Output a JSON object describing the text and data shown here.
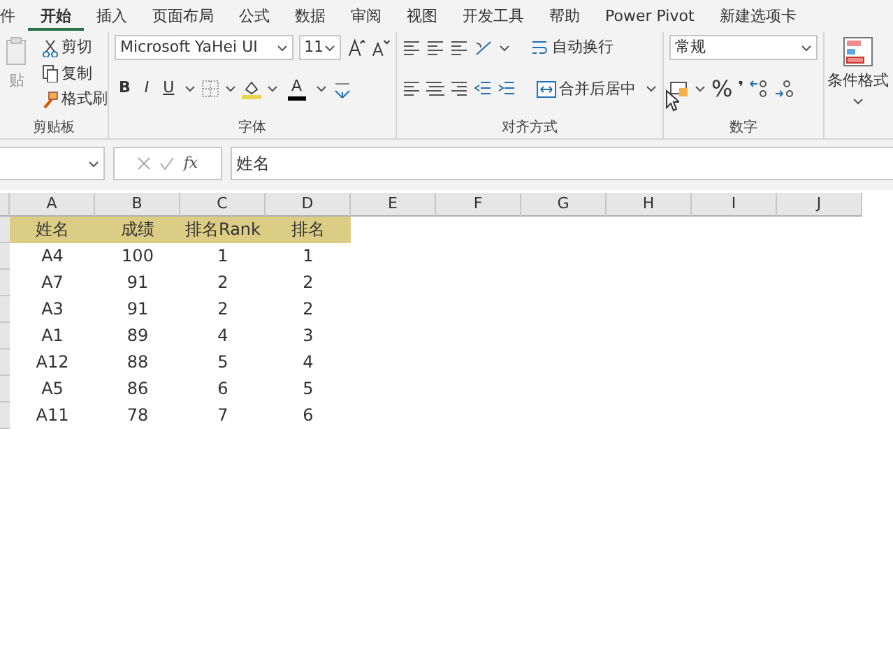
{
  "tabs": [
    {
      "label": "件",
      "selected": false
    },
    {
      "label": "开始",
      "selected": true
    },
    {
      "label": "插入",
      "selected": false
    },
    {
      "label": "页面布局",
      "selected": false
    },
    {
      "label": "公式",
      "selected": false
    },
    {
      "label": "数据",
      "selected": false
    },
    {
      "label": "审阅",
      "selected": false
    },
    {
      "label": "视图",
      "selected": false
    },
    {
      "label": "开发工具",
      "selected": false
    },
    {
      "label": "帮助",
      "selected": false
    },
    {
      "label": "Power Pivot",
      "selected": false
    },
    {
      "label": "新建选项卡",
      "selected": false
    }
  ],
  "clipboard": {
    "paste": "贴",
    "cut": "剪切",
    "copy": "复制",
    "painter": "格式刷",
    "label": "剪贴板"
  },
  "font": {
    "family": "Microsoft YaHei UI",
    "size": "11",
    "bold": "B",
    "italic": "I",
    "underline": "U",
    "color_letter": "A",
    "label": "字体"
  },
  "alignment": {
    "wrap": "自动换行",
    "merge": "合并后居中",
    "label": "对齐方式"
  },
  "number": {
    "format": "常规",
    "percent": "%",
    "comma": "❜",
    "label": "数字"
  },
  "styles": {
    "conditional": "条件格式"
  },
  "formula": {
    "fx": "fx",
    "value": "姓名"
  },
  "columns": [
    "A",
    "B",
    "C",
    "D",
    "E",
    "F",
    "G",
    "H",
    "I",
    "J"
  ],
  "header": [
    "姓名",
    "成绩",
    "排名Rank",
    "排名"
  ],
  "rows": [
    [
      "A4",
      "100",
      "1",
      "1"
    ],
    [
      "A7",
      "91",
      "2",
      "2"
    ],
    [
      "A3",
      "91",
      "2",
      "2"
    ],
    [
      "A1",
      "89",
      "4",
      "3"
    ],
    [
      "A12",
      "88",
      "5",
      "4"
    ],
    [
      "A5",
      "86",
      "6",
      "5"
    ],
    [
      "A11",
      "78",
      "7",
      "6"
    ]
  ]
}
